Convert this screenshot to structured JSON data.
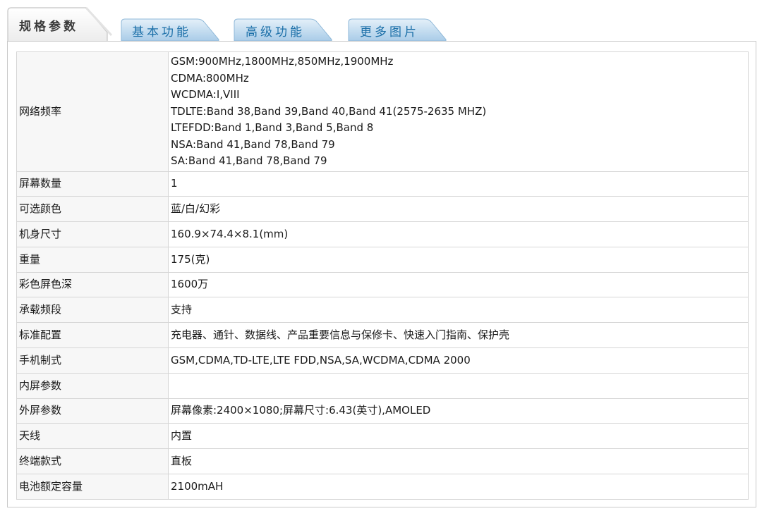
{
  "tabs": [
    {
      "label": "规格参数",
      "active": true
    },
    {
      "label": "基本功能",
      "active": false
    },
    {
      "label": "高级功能",
      "active": false
    },
    {
      "label": "更多图片",
      "active": false
    }
  ],
  "colors": {
    "tab_active_bg": "#f0f0f0",
    "tab_inactive_bg": "#c8dff0",
    "tab_inactive_text": "#1b6fa8",
    "border": "#d6d6d6",
    "key_bg": "#f7f7f7"
  },
  "network": {
    "label": "网络频率",
    "lines": [
      "GSM:900MHz,1800MHz,850MHz,1900MHz",
      "CDMA:800MHz",
      "WCDMA:I,VIII",
      "TDLTE:Band 38,Band 39,Band 40,Band 41(2575-2635 MHZ)",
      "LTEFDD:Band 1,Band 3,Band 5,Band 8",
      "NSA:Band 41,Band 78,Band 79",
      "SA:Band 41,Band 78,Band 79"
    ]
  },
  "specs": [
    {
      "label": "屏幕数量",
      "value": "1"
    },
    {
      "label": "可选颜色",
      "value": "蓝/白/幻彩"
    },
    {
      "label": "机身尺寸",
      "value": "160.9×74.4×8.1(mm)"
    },
    {
      "label": "重量",
      "value": "175(克)"
    },
    {
      "label": "彩色屏色深",
      "value": "1600万"
    },
    {
      "label": "承载频段",
      "value": "支持"
    },
    {
      "label": "标准配置",
      "value": "充电器、通针、数据线、产品重要信息与保修卡、快速入门指南、保护壳"
    },
    {
      "label": "手机制式",
      "value": "GSM,CDMA,TD-LTE,LTE FDD,NSA,SA,WCDMA,CDMA 2000"
    },
    {
      "label": "内屏参数",
      "value": ""
    },
    {
      "label": "外屏参数",
      "value": "屏幕像素:2400×1080;屏幕尺寸:6.43(英寸),AMOLED"
    },
    {
      "label": "天线",
      "value": "内置"
    },
    {
      "label": "终端款式",
      "value": "直板"
    },
    {
      "label": "电池额定容量",
      "value": "2100mAH"
    }
  ]
}
